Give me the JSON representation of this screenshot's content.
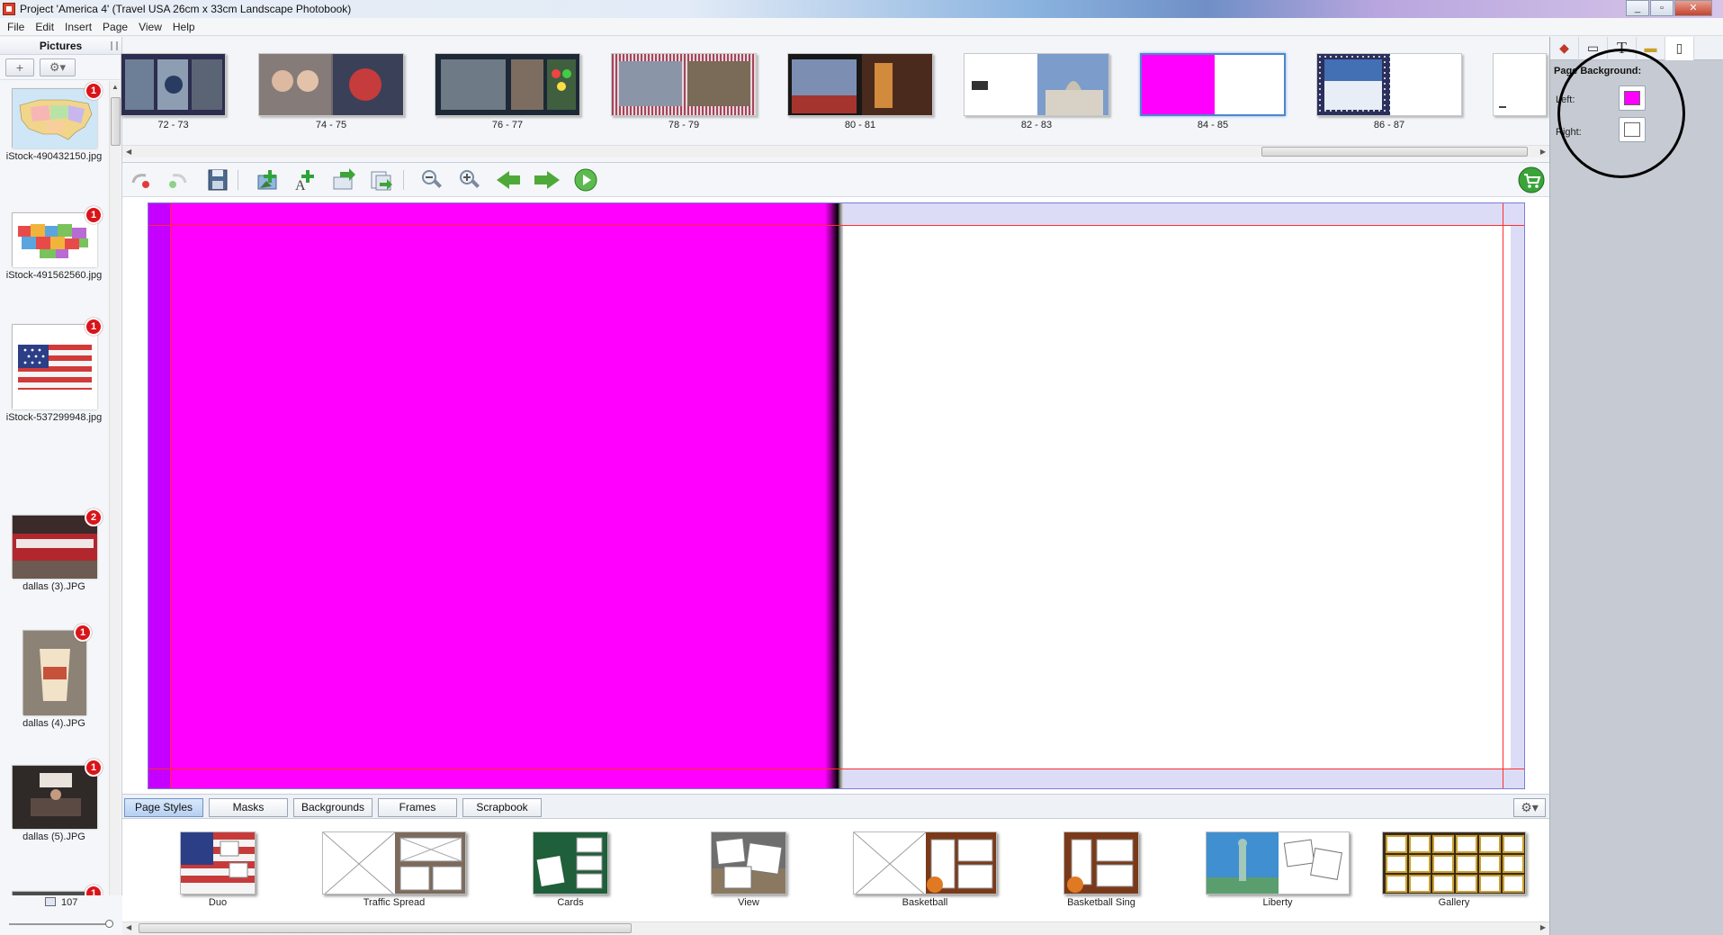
{
  "window": {
    "title": "Project 'America 4' (Travel USA 26cm x 33cm Landscape Photobook)",
    "minimize": "_",
    "maximize": "▫",
    "close": "✕"
  },
  "menu": [
    "File",
    "Edit",
    "Insert",
    "Page",
    "View",
    "Help"
  ],
  "pictures_panel": {
    "title": "Pictures",
    "add_icon": "plus-icon",
    "gear_icon": "gear-icon",
    "items": [
      {
        "name": "iStock-490432150.jpg",
        "badge": "1"
      },
      {
        "name": "iStock-491562560.jpg",
        "badge": "1"
      },
      {
        "name": "iStock-537299948.jpg",
        "badge": "1"
      },
      {
        "name": "dallas (3).JPG",
        "badge": "2"
      },
      {
        "name": "dallas (4).JPG",
        "badge": "1"
      },
      {
        "name": "dallas (5).JPG",
        "badge": "1"
      },
      {
        "name": "",
        "badge": "1"
      }
    ],
    "count": "107"
  },
  "page_strip": {
    "spreads": [
      {
        "label": "72 - 73"
      },
      {
        "label": "74 - 75"
      },
      {
        "label": "76 - 77"
      },
      {
        "label": "78 - 79"
      },
      {
        "label": "80 - 81"
      },
      {
        "label": "82 - 83"
      },
      {
        "label": "84 - 85",
        "selected": true
      },
      {
        "label": "86 - 87"
      }
    ]
  },
  "toolbar": {
    "icons": [
      "undo-icon",
      "redo-icon",
      "save-icon",
      "add-photo-icon",
      "add-text-icon",
      "import-icon",
      "export-icon",
      "zoom-out-icon",
      "zoom-in-icon",
      "previous-page-icon",
      "next-page-icon",
      "play-icon"
    ],
    "cart_icon": "cart-icon"
  },
  "canvas": {
    "left_page_background": "#ff00ff",
    "right_page_background": "#ffffff"
  },
  "bottom_tabs": {
    "tabs": [
      "Page Styles",
      "Masks",
      "Backgrounds",
      "Frames",
      "Scrapbook"
    ],
    "active": "Page Styles"
  },
  "page_styles": [
    "Duo",
    "Traffic Spread",
    "Cards",
    "View",
    "Basketball",
    "Basketball Sing",
    "Liberty",
    "Gallery"
  ],
  "right_panel": {
    "heading": "Page Background:",
    "left_label": "Left:",
    "right_label": "Right:",
    "left_color": "#ff00ff",
    "right_color": "#ffffff",
    "tab_icons": [
      "shapes-icon",
      "frame-icon",
      "text-icon",
      "ruler-icon",
      "page-icon"
    ],
    "tab_glyphs": [
      "◆",
      "▭",
      "T",
      "▬",
      "▯"
    ]
  },
  "colors": {
    "accent": "#4e86cf",
    "magenta": "#ff00ff",
    "badge_red": "#d9151a",
    "guide_red": "#ff2d2d"
  }
}
